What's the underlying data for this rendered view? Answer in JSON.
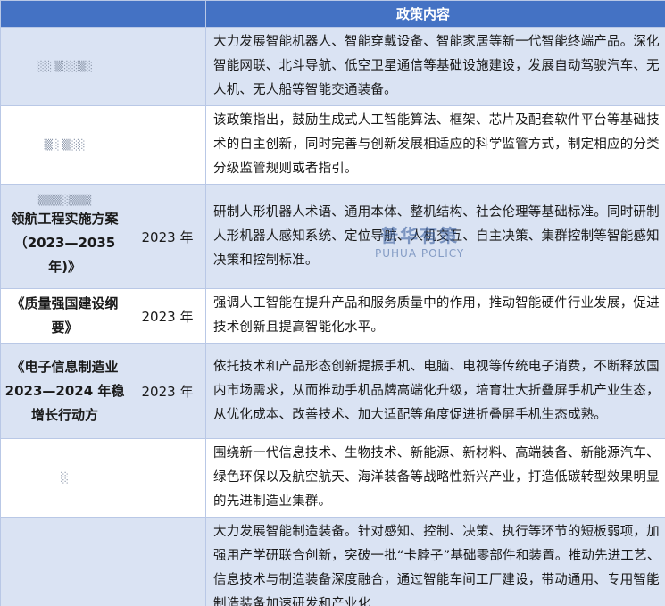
{
  "header": {
    "col3_title": "政策内容"
  },
  "rows": [
    {
      "name": "",
      "name_faint": "░░ ▒░░▒░",
      "year": "",
      "content": "大力发展智能机器人、智能穿戴设备、智能家居等新一代智能终端产品。深化智能网联、北斗导航、低空卫星通信等基础设施建设，发展自动驾驶汽车、无人机、无人船等智能交通装备。"
    },
    {
      "name": "",
      "name_faint": "▒░ ▒░░",
      "year": "",
      "content": "该政策指出，鼓励生成式人工智能算法、框架、芯片及配套软件平台等基础技术的自主创新，同时完善与创新发展相适应的科学监管方式，制定相应的分类分级监管规则或者指引。"
    },
    {
      "name": "领航工程实施方案（2023—2035 年)》",
      "name_faint": "▒▒▒░▒▒▒",
      "year": "2023 年",
      "content": "研制人形机器人术语、通用本体、整机结构、社会伦理等基础标准。同时研制人形机器人感知系统、定位导航、人机交互、自主决策、集群控制等智能感知决策和控制标准。"
    },
    {
      "name": "《质量强国建设纲要》",
      "name_faint": "",
      "year": "2023 年",
      "content": "强调人工智能在提升产品和服务质量中的作用，推动智能硬件行业发展，促进技术创新且提高智能化水平。"
    },
    {
      "name": "《电子信息制造业 2023—2024 年稳增长行动方",
      "name_faint": "",
      "year": "2023 年",
      "content": "依托技术和产品形态创新提振手机、电脑、电视等传统电子消费，不断释放国内市场需求，从而推动手机品牌高端化升级，培育壮大折叠屏手机产业生态，从优化成本、改善技术、加大适配等角度促进折叠屏手机生态成熟。"
    },
    {
      "name": "",
      "name_faint": "░",
      "year": "",
      "content": "围绕新一代信息技术、生物技术、新能源、新材料、高端装备、新能源汽车、绿色环保以及航空航天、海洋装备等战略性新兴产业，打造低碳转型效果明显的先进制造业集群。"
    },
    {
      "name": "",
      "name_faint": "",
      "year": "",
      "content": "大力发展智能制造装备。针对感知、控制、决策、执行等环节的短板弱项，加强用产学研联合创新，突破一批“卡脖子”基础零部件和装置。推动先进工艺、信息技术与制造装备深度融合，通过智能车间工厂建设，带动通用、专用智能制造装备加速研发和产业化"
    }
  ],
  "watermark": {
    "cn": "普华有策",
    "en": "PUHUA POLICY"
  },
  "colors": {
    "header_bg": "#4472c4",
    "alt_row_bg": "#dae3f3",
    "border": "#b9c8e6"
  }
}
